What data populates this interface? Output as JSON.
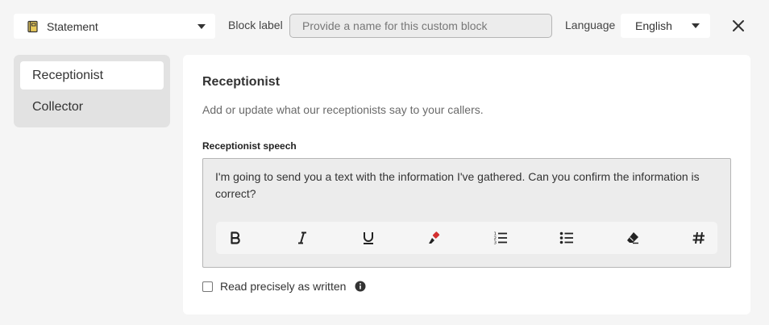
{
  "header": {
    "block_type": "Statement",
    "block_label_text": "Block label",
    "block_label_placeholder": "Provide a name for this custom block",
    "language_text": "Language",
    "language_value": "English"
  },
  "sidebar": {
    "items": [
      {
        "label": "Receptionist",
        "active": true
      },
      {
        "label": "Collector",
        "active": false
      }
    ]
  },
  "panel": {
    "title": "Receptionist",
    "description": "Add or update what our receptionists say to your callers.",
    "field_label": "Receptionist speech",
    "speech": "I'm going to send you a text with the information I've gathered. Can you confirm the information is correct?",
    "toolbar": [
      "bold-icon",
      "italic-icon",
      "underline-icon",
      "highlighter-icon",
      "numbered-list-icon",
      "bullet-list-icon",
      "eraser-icon",
      "hashtag-icon"
    ],
    "read_precisely_label": "Read precisely as written",
    "read_precisely_checked": false
  },
  "colors": {
    "highlighter_accent": "#d32f2f",
    "book_accent": "#c9a227"
  }
}
